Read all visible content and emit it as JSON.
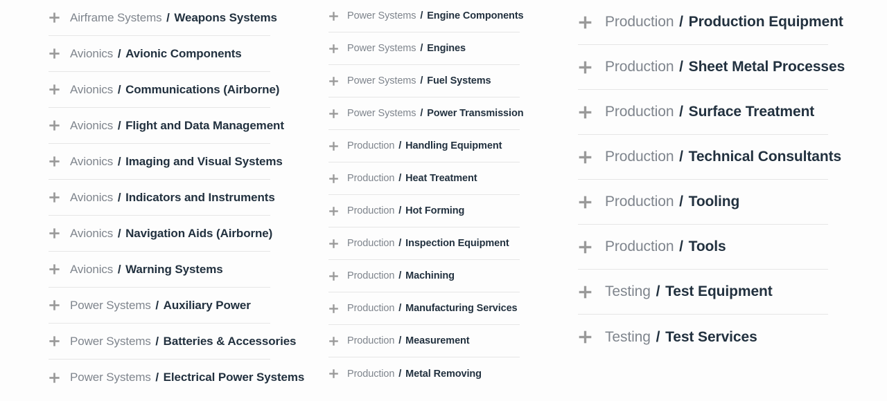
{
  "theme": {
    "background": "#fdfdfd",
    "divider": "#e6e6e6",
    "prefix_color": "#7f858d",
    "name_color": "#22313f",
    "icon_color": "#9a9a9a"
  },
  "icons": {
    "expand": "plus-icon"
  },
  "separator": "/",
  "columns": [
    {
      "id": "column-left",
      "items": [
        {
          "prefix": "Airframe Systems",
          "name": "Weapons Systems"
        },
        {
          "prefix": "Avionics",
          "name": "Avionic Components"
        },
        {
          "prefix": "Avionics",
          "name": "Communications (Airborne)"
        },
        {
          "prefix": "Avionics",
          "name": "Flight and Data Management"
        },
        {
          "prefix": "Avionics",
          "name": "Imaging and Visual Systems"
        },
        {
          "prefix": "Avionics",
          "name": "Indicators and Instruments"
        },
        {
          "prefix": "Avionics",
          "name": "Navigation Aids (Airborne)"
        },
        {
          "prefix": "Avionics",
          "name": "Warning Systems"
        },
        {
          "prefix": "Power Systems",
          "name": "Auxiliary Power"
        },
        {
          "prefix": "Power Systems",
          "name": "Batteries & Accessories"
        },
        {
          "prefix": "Power Systems",
          "name": "Electrical Power Systems"
        }
      ]
    },
    {
      "id": "column-middle",
      "items": [
        {
          "prefix": "Power Systems",
          "name": "Engine Components"
        },
        {
          "prefix": "Power Systems",
          "name": "Engines"
        },
        {
          "prefix": "Power Systems",
          "name": "Fuel Systems"
        },
        {
          "prefix": "Power Systems",
          "name": "Power Transmission"
        },
        {
          "prefix": "Production",
          "name": "Handling Equipment"
        },
        {
          "prefix": "Production",
          "name": "Heat Treatment"
        },
        {
          "prefix": "Production",
          "name": "Hot Forming"
        },
        {
          "prefix": "Production",
          "name": "Inspection Equipment"
        },
        {
          "prefix": "Production",
          "name": "Machining"
        },
        {
          "prefix": "Production",
          "name": "Manufacturing Services"
        },
        {
          "prefix": "Production",
          "name": "Measurement"
        },
        {
          "prefix": "Production",
          "name": "Metal Removing"
        }
      ]
    },
    {
      "id": "column-right",
      "items": [
        {
          "prefix": "Production",
          "name": "Production Equipment"
        },
        {
          "prefix": "Production",
          "name": "Sheet Metal Processes"
        },
        {
          "prefix": "Production",
          "name": "Surface Treatment"
        },
        {
          "prefix": "Production",
          "name": "Technical Consultants"
        },
        {
          "prefix": "Production",
          "name": "Tooling"
        },
        {
          "prefix": "Production",
          "name": "Tools"
        },
        {
          "prefix": "Testing",
          "name": "Test Equipment"
        },
        {
          "prefix": "Testing",
          "name": "Test Services"
        }
      ]
    }
  ]
}
